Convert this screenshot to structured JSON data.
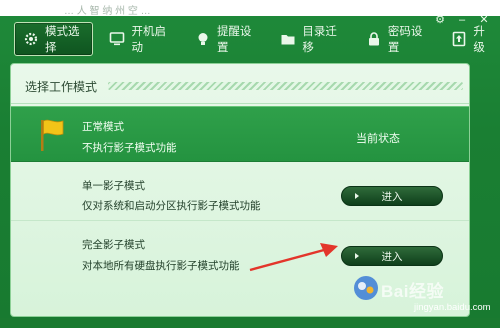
{
  "outer": {
    "caption": "… 人 智 纳 州 空 …"
  },
  "window": {
    "controls": [
      "⚙",
      "–",
      "✕"
    ]
  },
  "toolbar": {
    "items": [
      {
        "label": "模式选择",
        "icon": "gear-icon",
        "active": true
      },
      {
        "label": "开机启动",
        "icon": "monitor-icon"
      },
      {
        "label": "提醒设置",
        "icon": "bulb-icon"
      },
      {
        "label": "目录迁移",
        "icon": "folder-icon"
      },
      {
        "label": "密码设置",
        "icon": "lock-icon"
      },
      {
        "label": "升级",
        "icon": "upgrade-icon"
      }
    ]
  },
  "panel": {
    "title": "选择工作模式",
    "modes": [
      {
        "name": "正常模式",
        "desc": "不执行影子模式功能",
        "status": "当前状态"
      },
      {
        "name": "单一影子模式",
        "desc": "仅对系统和启动分区执行影子模式功能",
        "button": "进入"
      },
      {
        "name": "完全影子模式",
        "desc": "对本地所有硬盘执行影子模式功能",
        "button": "进入"
      }
    ]
  },
  "watermark": {
    "brand": "Bai经验",
    "url": "jingyan.baidu.com"
  },
  "colors": {
    "window_green": "#1a7f33",
    "panel_bg": "#e2f6e4",
    "current_row": "#2a9a45",
    "button_dark": "#0f3f1b",
    "flag_yellow": "#f2c418",
    "arrow_red": "#e3352b"
  }
}
